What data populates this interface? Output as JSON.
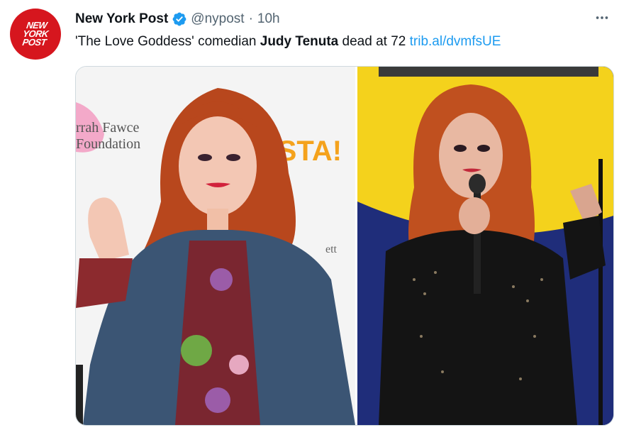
{
  "account": {
    "display_name": "New York Post",
    "handle": "@nypost",
    "separator": "·",
    "time": "10h",
    "avatar_lines": [
      "NEW",
      "YORK",
      "POST"
    ]
  },
  "tweet": {
    "text_before": "'The Love Goddess' comedian ",
    "text_bold": "Judy Tenuta",
    "text_after": " dead at 72 ",
    "link_text": "trib.al/dvmfsUE"
  },
  "media": {
    "left_backdrop_text": [
      "rrah Fawce",
      "Foundation",
      "ESTA!",
      "ett"
    ],
    "right_photo": "comedian on stage with microphone"
  },
  "colors": {
    "brand_red": "#d6161e",
    "verified_blue": "#1d9bf0",
    "link_blue": "#1d9bf0",
    "secondary_text": "#536471"
  },
  "icons": {
    "verified": "verified-badge-icon",
    "more": "more-dots-icon"
  }
}
